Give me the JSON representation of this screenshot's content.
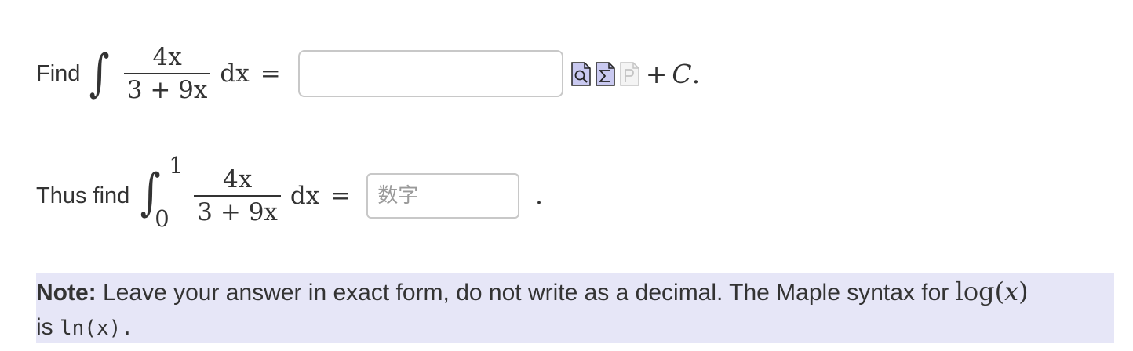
{
  "q1": {
    "lead": "Find",
    "integral": "∫",
    "numerator": "4x",
    "denominator": "3 + 9x",
    "dx": "dx",
    "eq": "=",
    "answer_value": "",
    "answer_placeholder": "",
    "tools": [
      "preview-icon",
      "sigma-palette-icon",
      "plot-icon"
    ],
    "plus": "+",
    "constant": "C",
    "trailing": "."
  },
  "q2": {
    "lead": "Thus find",
    "integral": "∫",
    "upper": "1",
    "lower": "0",
    "numerator": "4x",
    "denominator": "3 + 9x",
    "dx": "dx",
    "eq": "=",
    "answer_value": "",
    "answer_placeholder": "数字",
    "trailing": "."
  },
  "note": {
    "label": "Note:",
    "text": " Leave your answer in exact form, do not write as a decimal. The Maple syntax for ",
    "fn": "log",
    "arg": "x",
    "line2_prefix": "is ",
    "code": "ln(x)",
    "line2_suffix": "."
  }
}
